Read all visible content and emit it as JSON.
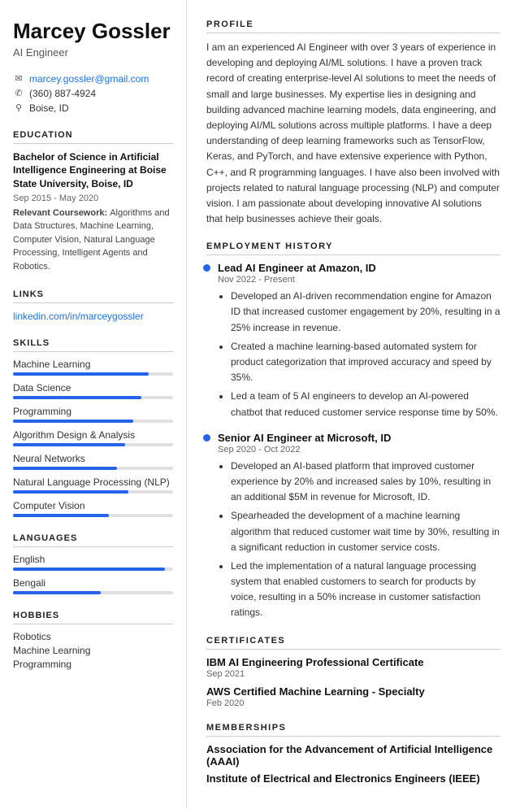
{
  "sidebar": {
    "name": "Marcey Gossler",
    "title": "AI Engineer",
    "contact": {
      "email": "marcey.gossler@gmail.com",
      "phone": "(360) 887-4924",
      "location": "Boise, ID"
    },
    "education_section": "EDUCATION",
    "education_degree": "Bachelor of Science in Artificial Intelligence Engineering at Boise State University, Boise, ID",
    "education_date": "Sep 2015 - May 2020",
    "education_coursework_label": "Relevant Coursework:",
    "education_coursework": "Algorithms and Data Structures, Machine Learning, Computer Vision, Natural Language Processing, Intelligent Agents and Robotics.",
    "links_section": "LINKS",
    "linkedin": "linkedin.com/in/marceygossler",
    "skills_section": "SKILLS",
    "skills": [
      {
        "label": "Machine Learning",
        "pct": 85
      },
      {
        "label": "Data Science",
        "pct": 80
      },
      {
        "label": "Programming",
        "pct": 75
      },
      {
        "label": "Algorithm Design & Analysis",
        "pct": 70
      },
      {
        "label": "Neural Networks",
        "pct": 65
      },
      {
        "label": "Natural Language Processing (NLP)",
        "pct": 72
      },
      {
        "label": "Computer Vision",
        "pct": 60
      }
    ],
    "languages_section": "LANGUAGES",
    "languages": [
      {
        "label": "English",
        "pct": 95
      },
      {
        "label": "Bengali",
        "pct": 55
      }
    ],
    "hobbies_section": "HOBBIES",
    "hobbies": [
      "Robotics",
      "Machine Learning",
      "Programming"
    ]
  },
  "main": {
    "profile_section": "PROFILE",
    "profile_text": "I am an experienced AI Engineer with over 3 years of experience in developing and deploying AI/ML solutions. I have a proven track record of creating enterprise-level AI solutions to meet the needs of small and large businesses. My expertise lies in designing and building advanced machine learning models, data engineering, and deploying AI/ML solutions across multiple platforms. I have a deep understanding of deep learning frameworks such as TensorFlow, Keras, and PyTorch, and have extensive experience with Python, C++, and R programming languages. I have also been involved with projects related to natural language processing (NLP) and computer vision. I am passionate about developing innovative AI solutions that help businesses achieve their goals.",
    "employment_section": "EMPLOYMENT HISTORY",
    "jobs": [
      {
        "title": "Lead AI Engineer at Amazon, ID",
        "date": "Nov 2022 - Present",
        "bullets": [
          "Developed an AI-driven recommendation engine for Amazon ID that increased customer engagement by 20%, resulting in a 25% increase in revenue.",
          "Created a machine learning-based automated system for product categorization that improved accuracy and speed by 35%.",
          "Led a team of 5 AI engineers to develop an AI-powered chatbot that reduced customer service response time by 50%."
        ]
      },
      {
        "title": "Senior AI Engineer at Microsoft, ID",
        "date": "Sep 2020 - Oct 2022",
        "bullets": [
          "Developed an AI-based platform that improved customer experience by 20% and increased sales by 10%, resulting in an additional $5M in revenue for Microsoft, ID.",
          "Spearheaded the development of a machine learning algorithm that reduced customer wait time by 30%, resulting in a significant reduction in customer service costs.",
          "Led the implementation of a natural language processing system that enabled customers to search for products by voice, resulting in a 50% increase in customer satisfaction ratings."
        ]
      }
    ],
    "certificates_section": "CERTIFICATES",
    "certificates": [
      {
        "title": "IBM AI Engineering Professional Certificate",
        "date": "Sep 2021"
      },
      {
        "title": "AWS Certified Machine Learning - Specialty",
        "date": "Feb 2020"
      }
    ],
    "memberships_section": "MEMBERSHIPS",
    "memberships": [
      "Association for the Advancement of Artificial Intelligence (AAAI)",
      "Institute of Electrical and Electronics Engineers (IEEE)"
    ]
  }
}
